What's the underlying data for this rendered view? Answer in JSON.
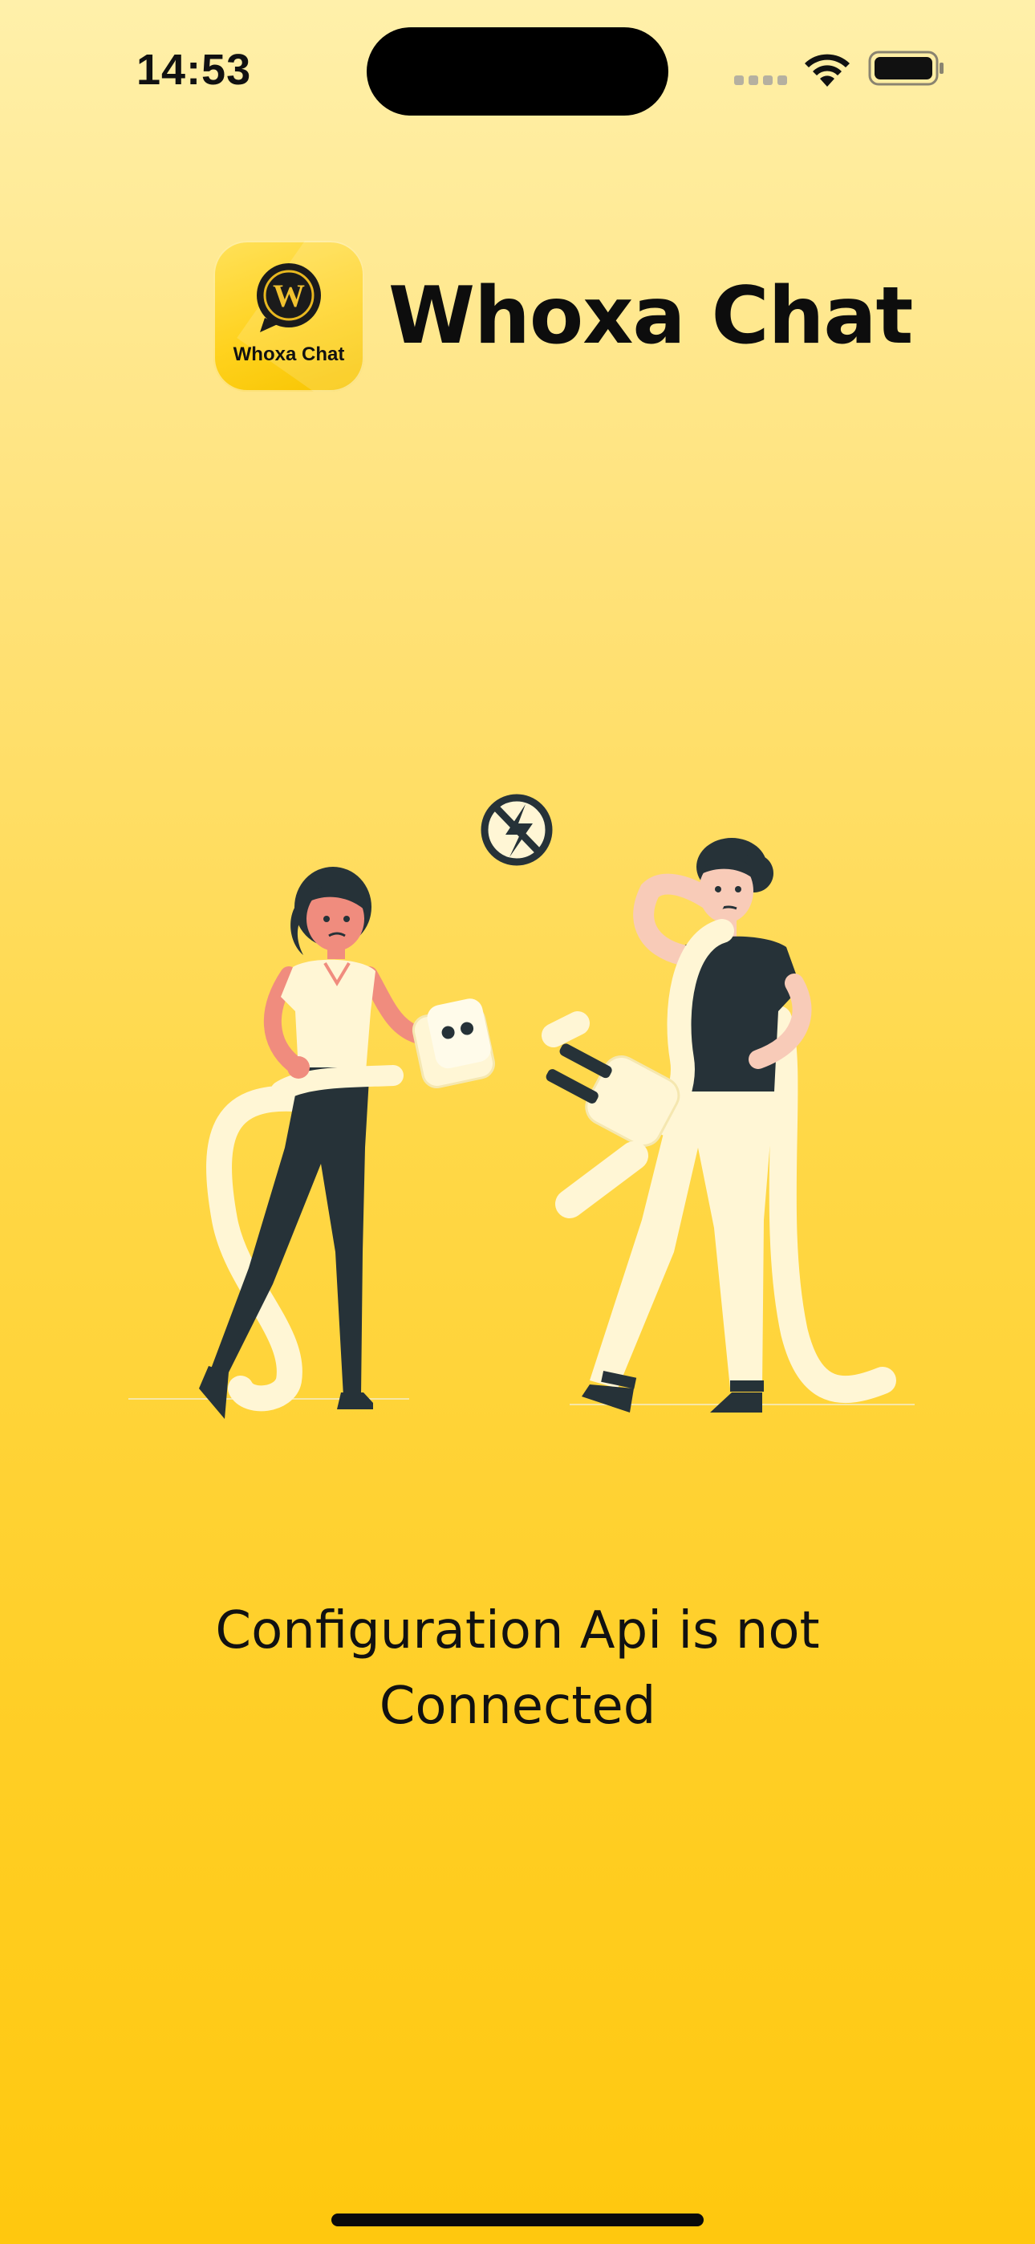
{
  "status_bar": {
    "time": "14:53",
    "icons": [
      "cellular-signal-icon",
      "wifi-icon",
      "battery-icon"
    ]
  },
  "header": {
    "app_icon_label": "Whoxa Chat",
    "app_icon_letter": "W",
    "app_name": "Whoxa Chat"
  },
  "illustration": {
    "description_icon": "unplugged-connection-illustration",
    "symbol_icon": "no-electricity-icon"
  },
  "message": {
    "line1": "Configuration Api is not",
    "line2": "Connected"
  },
  "colors": {
    "background_top": "#FFF0AA",
    "background_bottom": "#FFC80E",
    "brand_yellow": "#FFD21E",
    "ink": "#111111",
    "skin": "#F08C7E",
    "dark": "#263238",
    "cream": "#FFF6D5"
  }
}
